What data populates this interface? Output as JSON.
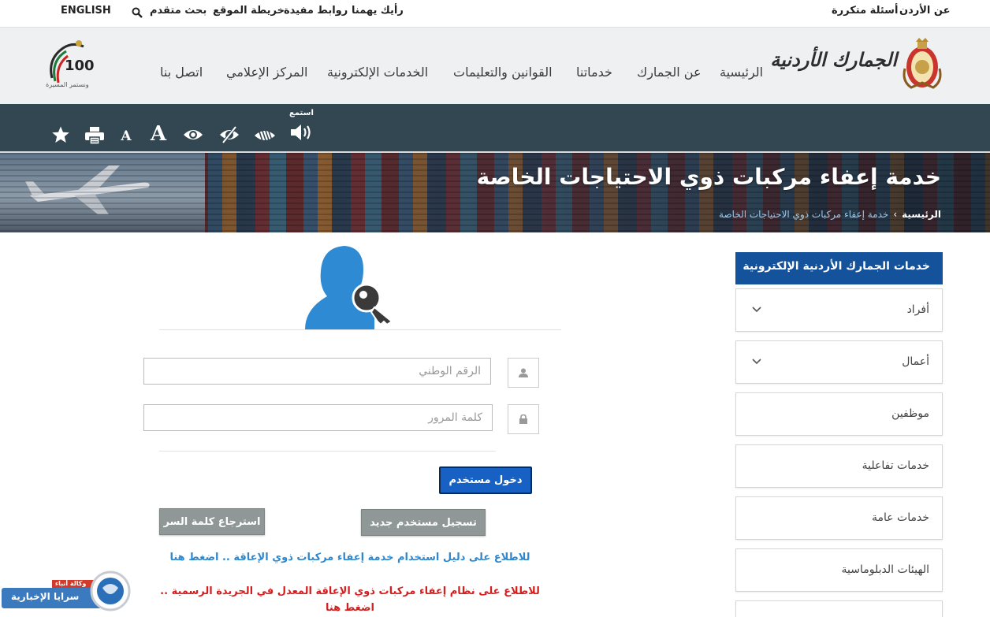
{
  "topbar": {
    "english": "ENGLISH",
    "advanced_search": "بحث متقدم",
    "sitemap": "خريطة الموقع",
    "useful_links": "روابط مفيدة",
    "feedback": "رأيك يهمنا",
    "about_jordan": "عن الأردن",
    "faq": "أسئلة متكررة"
  },
  "header": {
    "logo_text": "الجمارك الأردنية",
    "badge_number": "100",
    "badge_caption": "ونستمر المسيرة",
    "nav": {
      "home": "الرئيسية",
      "about": "عن الجمارك",
      "services": "خدماتنا",
      "laws": "القوانين والتعليمات",
      "eservices": "الخدمات الإلكترونية",
      "media": "المركز الإعلامي",
      "contact": "اتصل بنا"
    }
  },
  "accessibility": {
    "listen_label": "استمع",
    "font_large": "A",
    "font_small": "A"
  },
  "banner": {
    "title": "خدمة إعفاء مركبات ذوي الاحتياجات الخاصة",
    "breadcrumb_home": "الرئيسية",
    "breadcrumb_sep": "›",
    "breadcrumb_current": "خدمة إعفاء مركبات ذوي الاحتياجات الخاصة"
  },
  "sidebar": {
    "title": "خدمات الجمارك الأردنية الإلكترونية",
    "items": [
      {
        "label": "أفراد"
      },
      {
        "label": "أعمال"
      },
      {
        "label": "موظفين"
      },
      {
        "label": "خدمات تفاعلية"
      },
      {
        "label": "خدمات عامة"
      },
      {
        "label": "الهيئات الدبلوماسية"
      }
    ]
  },
  "login": {
    "national_id_placeholder": "الرقم الوطني",
    "password_placeholder": "كلمة المرور",
    "login_button": "دخول مستخدم",
    "register_button": "تسجيل مستخدم جديد",
    "recover_button": "استرجاع كلمة السر",
    "guide_link": "للاطلاع على دليل استخدام خدمة إعفاء مركبات ذوي الإعاقة .. اضغط هنا",
    "regulation_link": "للاطلاع على نظام إعفاء مركبات ذوي الإعاقة المعدل في الجريدة الرسمية .. اضغط هنا"
  },
  "watermark": {
    "name": "سرايا الإخبارية",
    "agency": "وكالة أنباء"
  },
  "colors": {
    "accent_blue": "#15529c",
    "access_bar": "#334753",
    "header_bg": "#eef0f1",
    "login_button": "#1761c5",
    "link_blue": "#2d88d0",
    "link_red": "#d41f1f"
  }
}
